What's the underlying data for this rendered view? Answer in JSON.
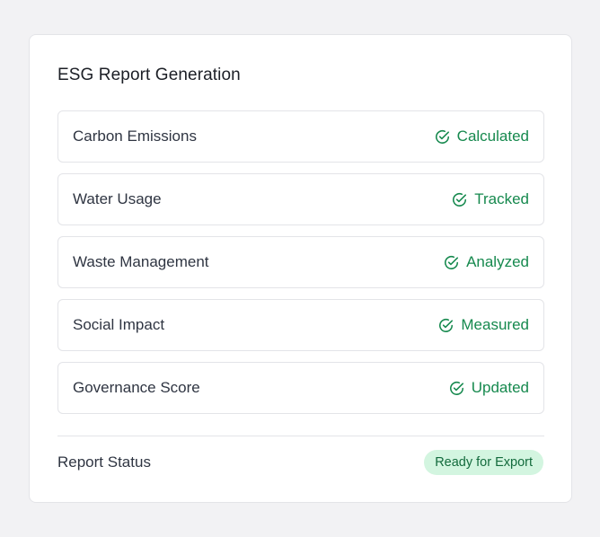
{
  "card": {
    "title": "ESG Report Generation",
    "items": [
      {
        "label": "Carbon Emissions",
        "status": "Calculated"
      },
      {
        "label": "Water Usage",
        "status": "Tracked"
      },
      {
        "label": "Waste Management",
        "status": "Analyzed"
      },
      {
        "label": "Social Impact",
        "status": "Measured"
      },
      {
        "label": "Governance Score",
        "status": "Updated"
      }
    ],
    "footer": {
      "label": "Report Status",
      "badge": "Ready for Export"
    }
  },
  "icons": {
    "status": "check-circle-icon"
  },
  "colors": {
    "background": "#f2f2f4",
    "success": "#16894e",
    "badge_bg": "#d3f5e0",
    "badge_text": "#136b3d"
  }
}
